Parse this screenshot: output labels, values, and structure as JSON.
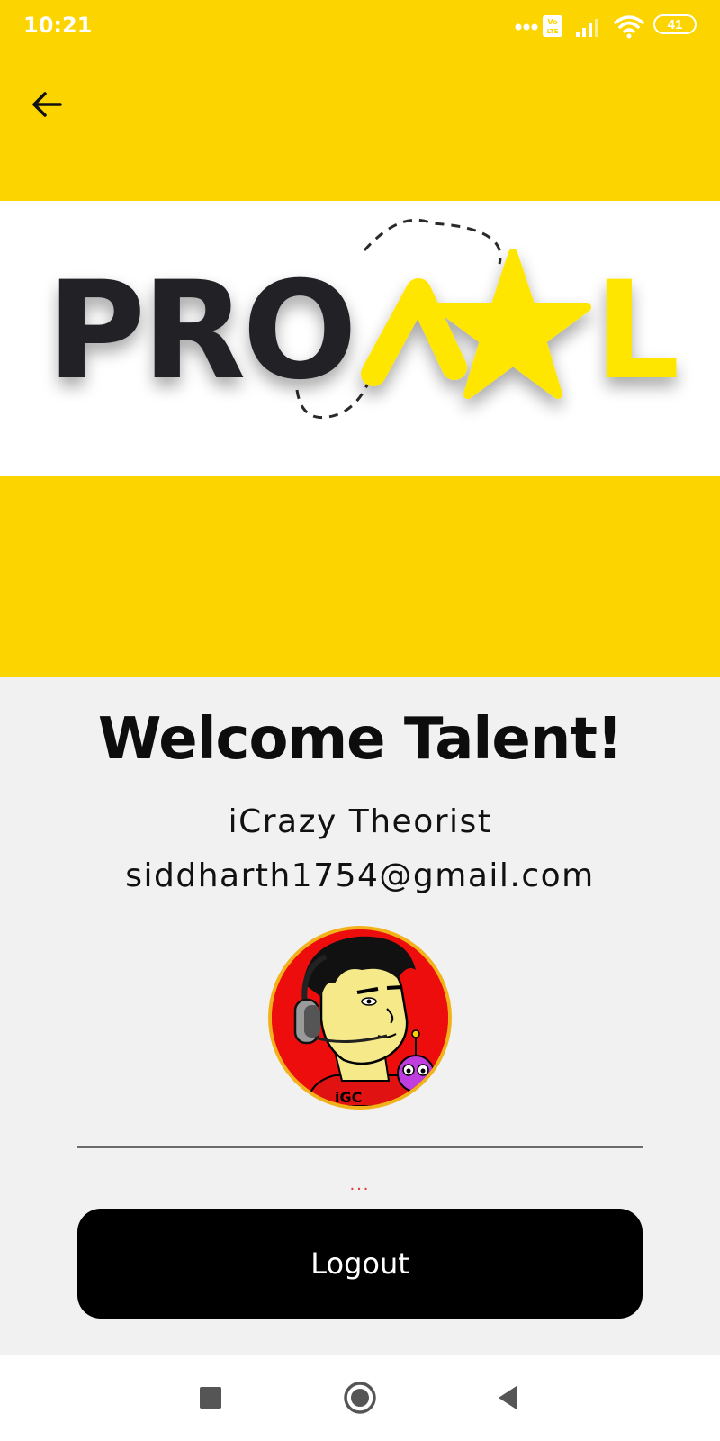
{
  "status_bar": {
    "time": "10:21",
    "battery_level": "41",
    "icons": [
      "more-dots-icon",
      "volte-icon",
      "signal-icon",
      "wifi-icon",
      "battery-icon"
    ]
  },
  "app_bar": {
    "back_icon": "arrow-back-icon"
  },
  "banner": {
    "logo_text_dark": "PRO",
    "logo_text_yellow": "L",
    "logo_colors": {
      "dark": "#242327",
      "yellow": "#ffe600"
    }
  },
  "profile": {
    "title": "Welcome Talent!",
    "name": "iCrazy Theorist",
    "email": "siddharth1754@gmail.com",
    "loading_indicator": "...",
    "logout_label": "Logout"
  },
  "colors": {
    "accent_yellow": "#fcd500",
    "content_bg": "#f1f1f1",
    "button_bg": "#000000",
    "loading_red": "#e53935"
  },
  "nav_bar": {
    "buttons": [
      "recents-square-icon",
      "home-circle-icon",
      "back-triangle-icon"
    ]
  }
}
